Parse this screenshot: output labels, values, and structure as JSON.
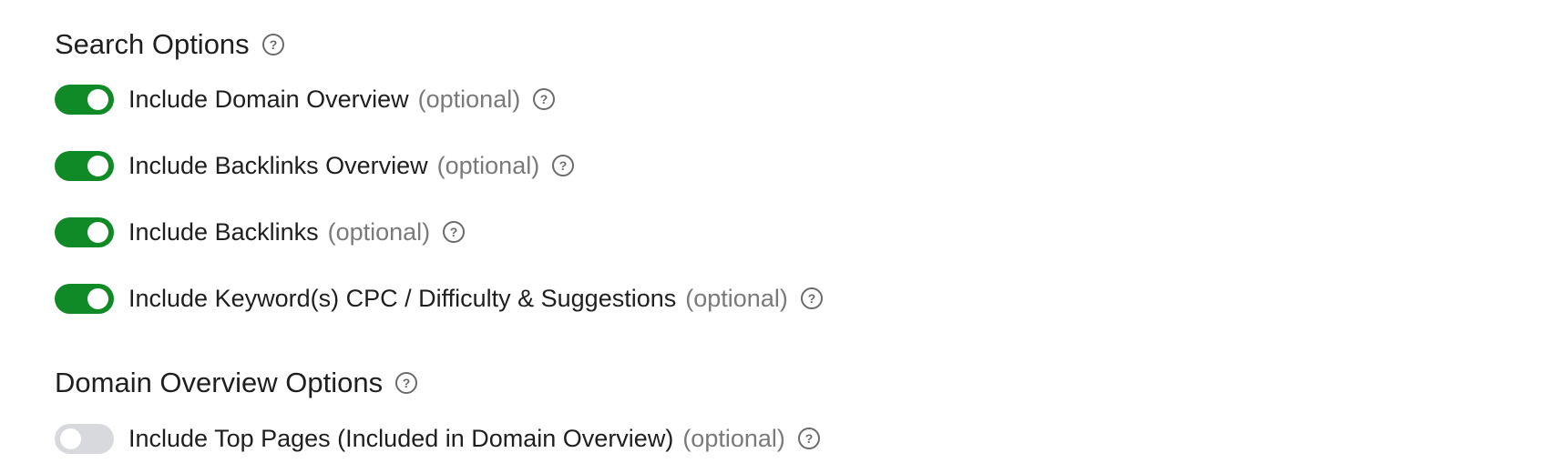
{
  "search_options": {
    "title": "Search Options",
    "help_icon": "question-circle-icon",
    "items": [
      {
        "label": "Include Domain Overview",
        "optional": "(optional)",
        "enabled": true
      },
      {
        "label": "Include Backlinks Overview",
        "optional": "(optional)",
        "enabled": true
      },
      {
        "label": "Include Backlinks",
        "optional": "(optional)",
        "enabled": true
      },
      {
        "label": "Include Keyword(s) CPC / Difficulty & Suggestions",
        "optional": "(optional)",
        "enabled": true
      }
    ]
  },
  "domain_overview_options": {
    "title": "Domain Overview Options",
    "help_icon": "question-circle-icon",
    "items": [
      {
        "label": "Include Top Pages (Included in Domain Overview)",
        "optional": "(optional)",
        "enabled": false
      }
    ]
  },
  "colors": {
    "toggle_on": "#0f8a26",
    "toggle_off": "#d7d9dc",
    "text": "#1f1f1f",
    "muted": "#7a7a7a",
    "icon": "#6b6b6b"
  }
}
